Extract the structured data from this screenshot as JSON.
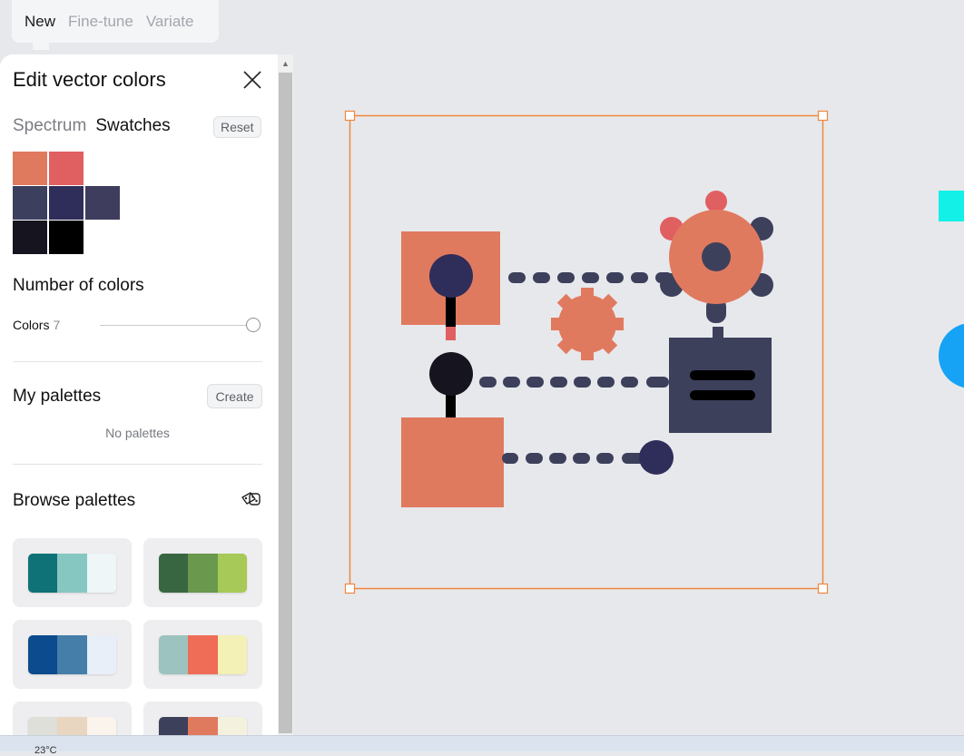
{
  "topbar": {
    "tabs": [
      "New",
      "Fine-tune",
      "Variate"
    ]
  },
  "panel": {
    "title": "Edit vector colors",
    "tab_spectrum": "Spectrum",
    "tab_swatches": "Swatches",
    "reset_label": "Reset",
    "swatches": [
      "#e07a5f",
      "#e05f61",
      "#3d3f5e",
      "#2f2d5a",
      "#3e3d5d",
      "#16141f",
      "#000000"
    ],
    "number_of_colors_title": "Number of colors",
    "colors_label": "Colors",
    "colors_value": "7",
    "my_palettes_title": "My palettes",
    "create_label": "Create",
    "no_palettes": "No palettes",
    "browse_palettes_title": "Browse palettes",
    "palettes": [
      [
        "#0e7276",
        "#87c7c1",
        "#eef6f7"
      ],
      [
        "#386641",
        "#6a994e",
        "#a7c957"
      ],
      [
        "#0b4b8e",
        "#457ea8",
        "#e8eff8"
      ],
      [
        "#9cc3bf",
        "#ef6c57",
        "#f3f1b5"
      ],
      [
        "#dedfd8",
        "#e8d6c0",
        "#faf4ec"
      ],
      [
        "#3d405b",
        "#e07a5f",
        "#f4f1de"
      ]
    ]
  },
  "canvas": {
    "colors": {
      "coral": "#e07a5f",
      "red": "#e05f61",
      "navy": "#3d405b",
      "indigo": "#2f2d5a",
      "dark": "#16141f",
      "black": "#000000",
      "selection": "#f0883e",
      "cyan": "#12f0e8",
      "blue": "#16a3f5"
    }
  },
  "taskbar": {
    "weather": "23°C"
  }
}
